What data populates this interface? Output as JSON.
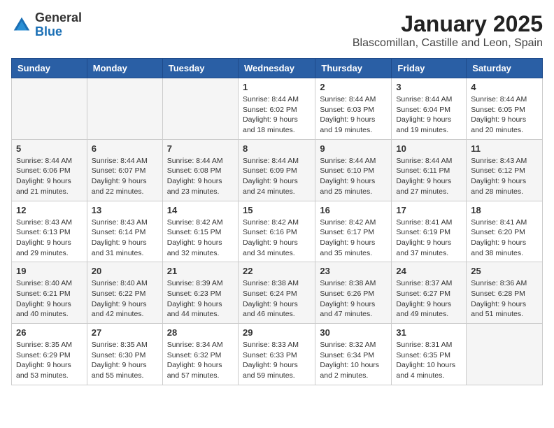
{
  "header": {
    "logo_general": "General",
    "logo_blue": "Blue",
    "month": "January 2025",
    "location": "Blascomillan, Castille and Leon, Spain"
  },
  "columns": [
    "Sunday",
    "Monday",
    "Tuesday",
    "Wednesday",
    "Thursday",
    "Friday",
    "Saturday"
  ],
  "weeks": [
    [
      {
        "day": "",
        "info": ""
      },
      {
        "day": "",
        "info": ""
      },
      {
        "day": "",
        "info": ""
      },
      {
        "day": "1",
        "info": "Sunrise: 8:44 AM\nSunset: 6:02 PM\nDaylight: 9 hours and 18 minutes."
      },
      {
        "day": "2",
        "info": "Sunrise: 8:44 AM\nSunset: 6:03 PM\nDaylight: 9 hours and 19 minutes."
      },
      {
        "day": "3",
        "info": "Sunrise: 8:44 AM\nSunset: 6:04 PM\nDaylight: 9 hours and 19 minutes."
      },
      {
        "day": "4",
        "info": "Sunrise: 8:44 AM\nSunset: 6:05 PM\nDaylight: 9 hours and 20 minutes."
      }
    ],
    [
      {
        "day": "5",
        "info": "Sunrise: 8:44 AM\nSunset: 6:06 PM\nDaylight: 9 hours and 21 minutes."
      },
      {
        "day": "6",
        "info": "Sunrise: 8:44 AM\nSunset: 6:07 PM\nDaylight: 9 hours and 22 minutes."
      },
      {
        "day": "7",
        "info": "Sunrise: 8:44 AM\nSunset: 6:08 PM\nDaylight: 9 hours and 23 minutes."
      },
      {
        "day": "8",
        "info": "Sunrise: 8:44 AM\nSunset: 6:09 PM\nDaylight: 9 hours and 24 minutes."
      },
      {
        "day": "9",
        "info": "Sunrise: 8:44 AM\nSunset: 6:10 PM\nDaylight: 9 hours and 25 minutes."
      },
      {
        "day": "10",
        "info": "Sunrise: 8:44 AM\nSunset: 6:11 PM\nDaylight: 9 hours and 27 minutes."
      },
      {
        "day": "11",
        "info": "Sunrise: 8:43 AM\nSunset: 6:12 PM\nDaylight: 9 hours and 28 minutes."
      }
    ],
    [
      {
        "day": "12",
        "info": "Sunrise: 8:43 AM\nSunset: 6:13 PM\nDaylight: 9 hours and 29 minutes."
      },
      {
        "day": "13",
        "info": "Sunrise: 8:43 AM\nSunset: 6:14 PM\nDaylight: 9 hours and 31 minutes."
      },
      {
        "day": "14",
        "info": "Sunrise: 8:42 AM\nSunset: 6:15 PM\nDaylight: 9 hours and 32 minutes."
      },
      {
        "day": "15",
        "info": "Sunrise: 8:42 AM\nSunset: 6:16 PM\nDaylight: 9 hours and 34 minutes."
      },
      {
        "day": "16",
        "info": "Sunrise: 8:42 AM\nSunset: 6:17 PM\nDaylight: 9 hours and 35 minutes."
      },
      {
        "day": "17",
        "info": "Sunrise: 8:41 AM\nSunset: 6:19 PM\nDaylight: 9 hours and 37 minutes."
      },
      {
        "day": "18",
        "info": "Sunrise: 8:41 AM\nSunset: 6:20 PM\nDaylight: 9 hours and 38 minutes."
      }
    ],
    [
      {
        "day": "19",
        "info": "Sunrise: 8:40 AM\nSunset: 6:21 PM\nDaylight: 9 hours and 40 minutes."
      },
      {
        "day": "20",
        "info": "Sunrise: 8:40 AM\nSunset: 6:22 PM\nDaylight: 9 hours and 42 minutes."
      },
      {
        "day": "21",
        "info": "Sunrise: 8:39 AM\nSunset: 6:23 PM\nDaylight: 9 hours and 44 minutes."
      },
      {
        "day": "22",
        "info": "Sunrise: 8:38 AM\nSunset: 6:24 PM\nDaylight: 9 hours and 46 minutes."
      },
      {
        "day": "23",
        "info": "Sunrise: 8:38 AM\nSunset: 6:26 PM\nDaylight: 9 hours and 47 minutes."
      },
      {
        "day": "24",
        "info": "Sunrise: 8:37 AM\nSunset: 6:27 PM\nDaylight: 9 hours and 49 minutes."
      },
      {
        "day": "25",
        "info": "Sunrise: 8:36 AM\nSunset: 6:28 PM\nDaylight: 9 hours and 51 minutes."
      }
    ],
    [
      {
        "day": "26",
        "info": "Sunrise: 8:35 AM\nSunset: 6:29 PM\nDaylight: 9 hours and 53 minutes."
      },
      {
        "day": "27",
        "info": "Sunrise: 8:35 AM\nSunset: 6:30 PM\nDaylight: 9 hours and 55 minutes."
      },
      {
        "day": "28",
        "info": "Sunrise: 8:34 AM\nSunset: 6:32 PM\nDaylight: 9 hours and 57 minutes."
      },
      {
        "day": "29",
        "info": "Sunrise: 8:33 AM\nSunset: 6:33 PM\nDaylight: 9 hours and 59 minutes."
      },
      {
        "day": "30",
        "info": "Sunrise: 8:32 AM\nSunset: 6:34 PM\nDaylight: 10 hours and 2 minutes."
      },
      {
        "day": "31",
        "info": "Sunrise: 8:31 AM\nSunset: 6:35 PM\nDaylight: 10 hours and 4 minutes."
      },
      {
        "day": "",
        "info": ""
      }
    ]
  ]
}
